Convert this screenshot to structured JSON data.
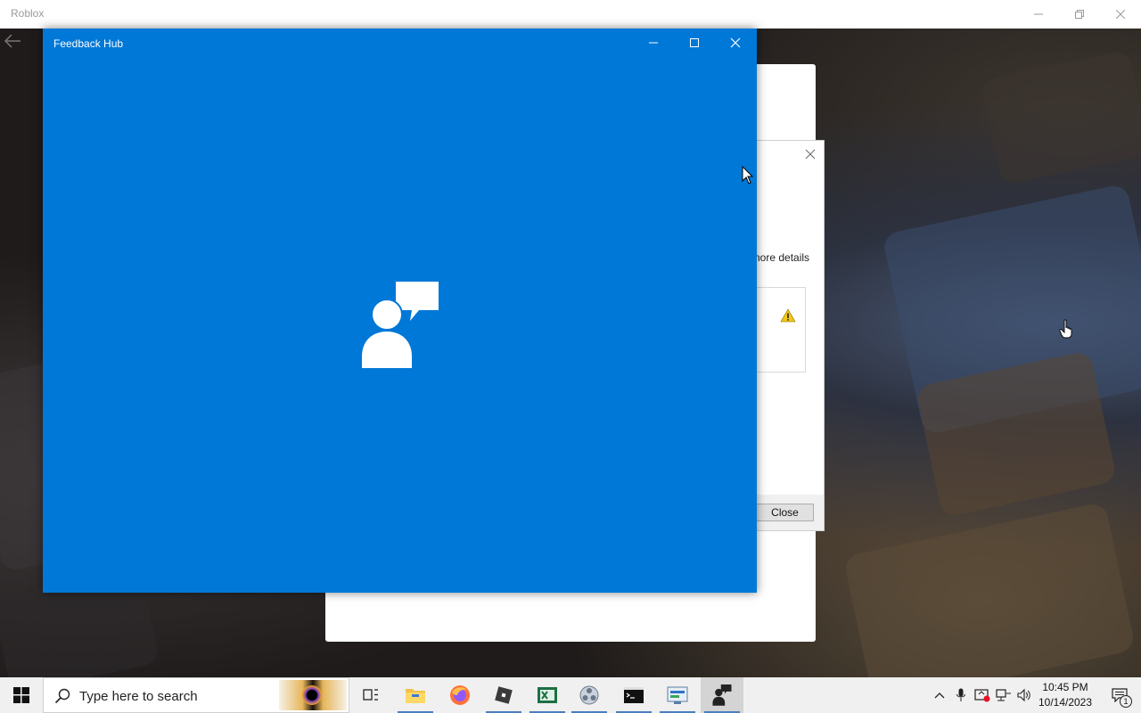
{
  "roblox": {
    "title": "Roblox"
  },
  "error_dialog": {
    "details_text": "nore details",
    "close_label": "Close"
  },
  "feedback_hub": {
    "title": "Feedback Hub",
    "background_color": "#0078d7"
  },
  "taskbar": {
    "search_placeholder": "Type here to search",
    "pinned_apps": [
      "task-view",
      "file-explorer",
      "firefox",
      "roblox",
      "excel",
      "obs",
      "terminal",
      "control-panel",
      "feedback-hub"
    ],
    "clock_time": "10:45 PM",
    "clock_date": "10/14/2023",
    "notification_count": "1"
  }
}
